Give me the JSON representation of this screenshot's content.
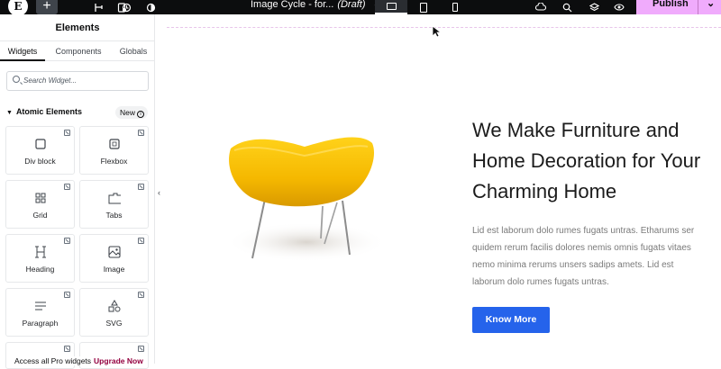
{
  "topbar": {
    "logo_label": "E",
    "add_label": "+",
    "document_title": "Image Cycle - for...",
    "document_status": "(Draft)",
    "publish_label": "Publish",
    "icons": [
      "elementor-logo-icon",
      "add-icon",
      "structure-icon",
      "page-settings-icon",
      "history-icon",
      "theme-icon",
      "desktop-icon",
      "tablet-icon",
      "mobile-icon",
      "integrations-icon",
      "search-icon",
      "layers-icon",
      "preview-icon",
      "chevron-down-icon"
    ]
  },
  "sidebar": {
    "title": "Elements",
    "tabs": [
      "Widgets",
      "Components",
      "Globals"
    ],
    "active_tab": "Widgets",
    "search_placeholder": "Search Widget...",
    "section_title": "Atomic Elements",
    "section_badge": "New",
    "widgets": [
      {
        "label": "Div block",
        "icon": "div-block-icon"
      },
      {
        "label": "Flexbox",
        "icon": "flexbox-icon"
      },
      {
        "label": "Grid",
        "icon": "grid-icon"
      },
      {
        "label": "Tabs",
        "icon": "tabs-icon"
      },
      {
        "label": "Heading",
        "icon": "heading-icon"
      },
      {
        "label": "Image",
        "icon": "image-icon"
      },
      {
        "label": "Paragraph",
        "icon": "paragraph-icon"
      },
      {
        "label": "SVG",
        "icon": "svg-icon"
      }
    ],
    "promo_text": "Access all Pro widgets",
    "promo_link": "Upgrade Now"
  },
  "canvas": {
    "heading": "We Make Furniture and Home Decoration for Your Charming Home",
    "paragraph": "Lid est laborum dolo rumes fugats untras. Etharums ser quidem rerum facilis dolores nemis omnis fugats vitaes nemo minima rerums unsers sadips amets. Lid est laborum dolo rumes fugats untras.",
    "button_label": "Know More",
    "accent_color": "#2563eb",
    "chair_color": "#f5b800"
  }
}
